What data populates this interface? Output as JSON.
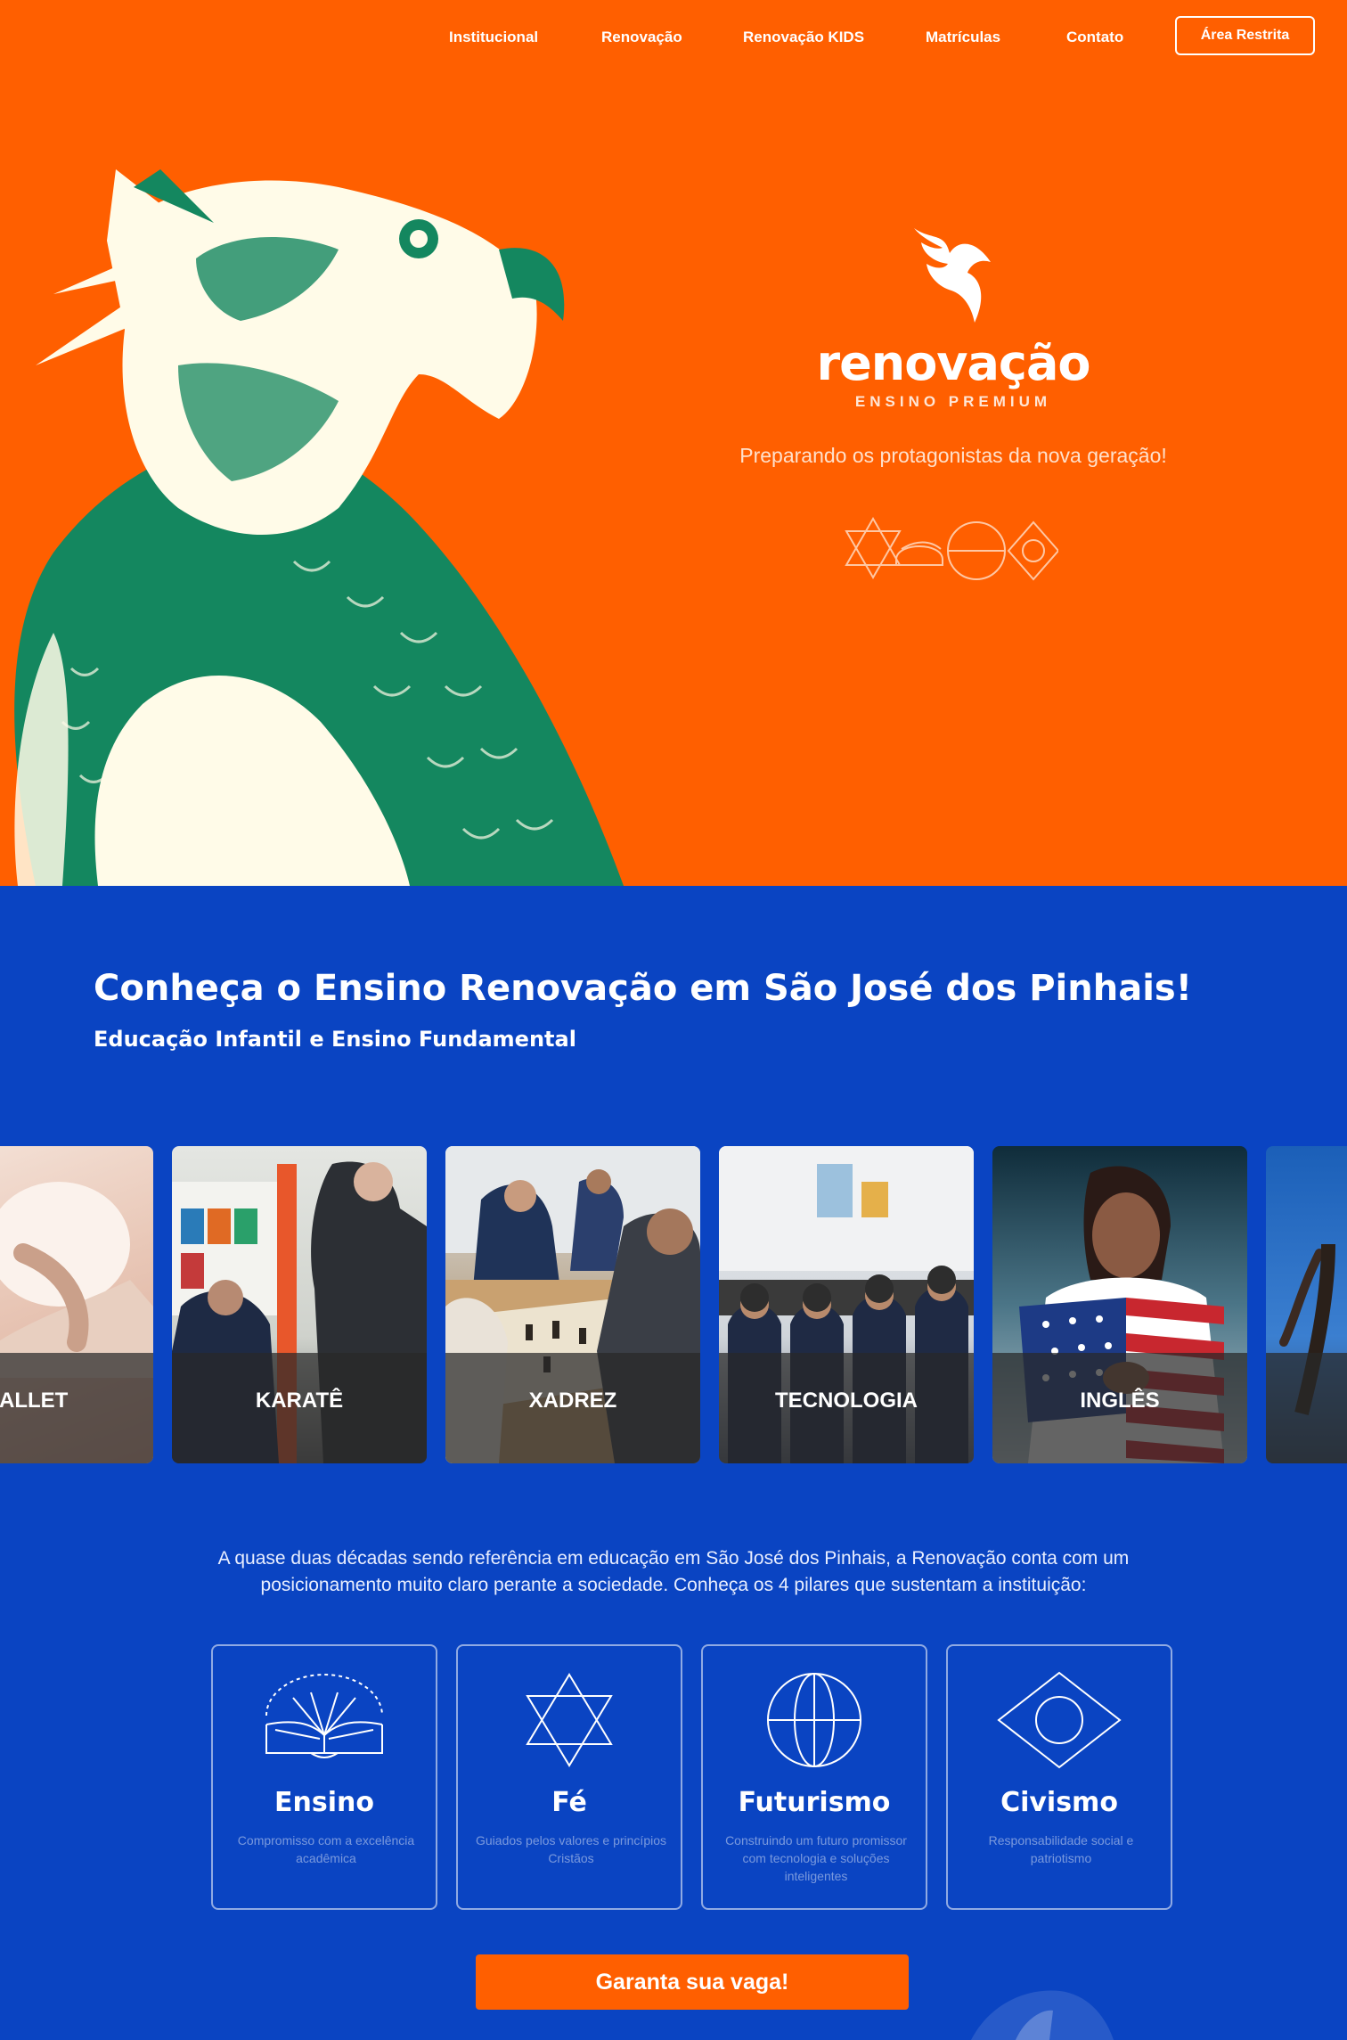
{
  "nav": {
    "items": [
      "Institucional",
      "Renovação",
      "Renovação KIDS",
      "Matrículas",
      "Contato"
    ],
    "restricted_label": "Área Restrita"
  },
  "hero": {
    "brand_name": "renovação",
    "brand_sub": "ENSINO PREMIUM",
    "tagline": "Preparando os protagonistas da nova geração!"
  },
  "section": {
    "title": "Conheça o Ensino Renovação em São José dos Pinhais!",
    "subtitle": "Educação Infantil e Ensino Fundamental"
  },
  "activities": [
    "BALLET",
    "KARATÊ",
    "XADREZ",
    "TECNOLOGIA",
    "INGLÊS"
  ],
  "intro": "A quase duas décadas sendo referência em educação em São José dos Pinhais, a Renovação conta com um posicionamento muito claro perante a sociedade. Conheça os 4 pilares que sustentam a instituição:",
  "pillars": [
    {
      "title": "Ensino",
      "desc": "Compromisso com a excelência acadêmica",
      "icon": "open-book-icon"
    },
    {
      "title": "Fé",
      "desc": "Guiados pelos valores e princípios Cristãos",
      "icon": "star-of-david-icon"
    },
    {
      "title": "Futurismo",
      "desc": "Construindo um futuro promissor com tecnologia e soluções inteligentes",
      "icon": "globe-icon"
    },
    {
      "title": "Civismo",
      "desc": "Responsabilidade social e patriotismo",
      "icon": "brazil-flag-icon"
    }
  ],
  "cta_label": "Garanta sua vaga!",
  "colors": {
    "orange": "#ff5f00",
    "blue": "#0a44c2",
    "green": "#14875f",
    "cream": "#fffbe8"
  }
}
